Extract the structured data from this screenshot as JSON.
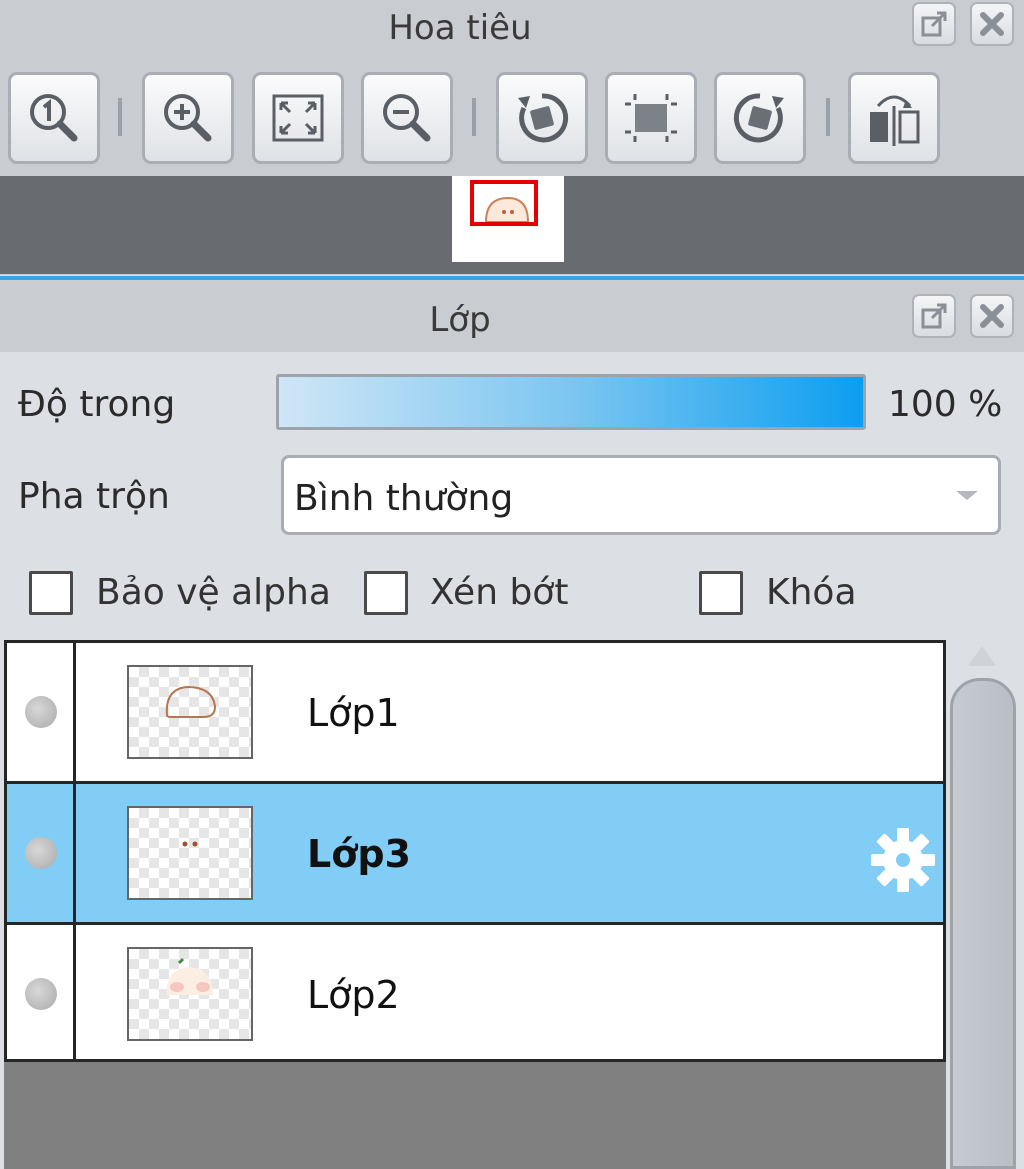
{
  "navigator": {
    "title": "Hoa tiêu",
    "tools": [
      {
        "icon": "actual-size-icon"
      },
      {
        "icon": "zoom-in-icon"
      },
      {
        "icon": "fit-screen-icon"
      },
      {
        "icon": "zoom-out-icon"
      },
      {
        "icon": "rotate-left-icon"
      },
      {
        "icon": "reset-rotation-icon"
      },
      {
        "icon": "rotate-right-icon"
      },
      {
        "icon": "flip-horizontal-icon"
      }
    ]
  },
  "layers_panel": {
    "title": "Lớp",
    "opacity_label": "Độ trong",
    "opacity_value": "100 %",
    "opacity_fraction": 1.0,
    "blend_label": "Pha trộn",
    "blend_value": "Bình thường",
    "checkboxes": [
      {
        "label": "Bảo vệ alpha",
        "checked": false
      },
      {
        "label": "Xén bớt",
        "checked": false
      },
      {
        "label": "Khóa",
        "checked": false
      }
    ],
    "layers": [
      {
        "name": "Lớp1",
        "selected": false
      },
      {
        "name": "Lớp3",
        "selected": true
      },
      {
        "name": "Lớp2",
        "selected": false
      }
    ]
  },
  "colors": {
    "accent": "#39a3e3",
    "selected_row": "#82cdf5",
    "nav_frame": "#e40000"
  }
}
